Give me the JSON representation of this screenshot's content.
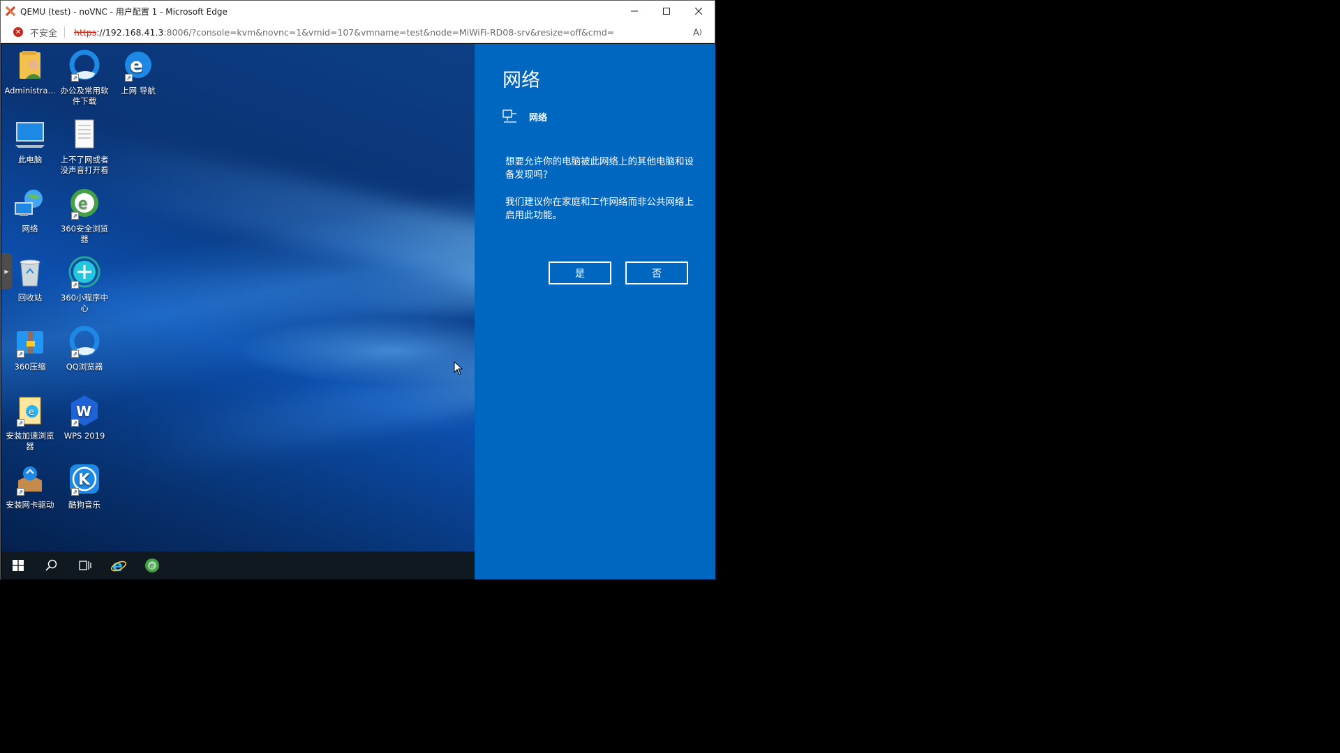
{
  "window": {
    "title": "QEMU (test) - noVNC - 用户配置 1 - Microsoft Edge",
    "app_icon": "novnc-icon"
  },
  "addressbar": {
    "security_label": "不安全",
    "url_scheme": "https",
    "url_host": "://192.168.41.3",
    "url_rest": ":8006/?console=kvm&novnc=1&vmid=107&vmname=test&node=MiWiFi-RD08-srv&resize=off&cmd="
  },
  "desktop": {
    "icons": [
      {
        "label": "Administra...",
        "icon": "user-folder-icon"
      },
      {
        "label": "办公及常用软件下载",
        "icon": "qq-browser-icon"
      },
      {
        "label": "上网 导航",
        "icon": "ie-icon"
      },
      {
        "label": "此电脑",
        "icon": "this-pc-icon"
      },
      {
        "label": "上不了网或者没声音打开看",
        "icon": "text-file-icon"
      },
      {
        "label": "网络",
        "icon": "network-icon"
      },
      {
        "label": "360安全浏览器",
        "icon": "360-browser-icon"
      },
      {
        "label": "回收站",
        "icon": "recycle-bin-icon"
      },
      {
        "label": "360小程序中心",
        "icon": "360-mini-icon"
      },
      {
        "label": "360压缩",
        "icon": "360-zip-icon"
      },
      {
        "label": "QQ浏览器",
        "icon": "qq-browser-icon"
      },
      {
        "label": "安装加速浏览器",
        "icon": "installer-icon"
      },
      {
        "label": "WPS 2019",
        "icon": "wps-icon"
      },
      {
        "label": "安装网卡驱动",
        "icon": "driver-installer-icon"
      },
      {
        "label": "酷狗音乐",
        "icon": "kugou-icon"
      }
    ]
  },
  "taskbar": {
    "items": [
      "start-icon",
      "search-icon",
      "task-view-icon",
      "ie-icon",
      "360-browser-icon"
    ]
  },
  "flyout": {
    "title": "网络",
    "network_name": "网络",
    "question": "想要允许你的电脑被此网络上的其他电脑和设备发现吗？",
    "recommendation": "我们建议你在家庭和工作网络而非公共网络上启用此功能。",
    "yes_label": "是",
    "no_label": "否",
    "bg_color": "#0067c0"
  }
}
